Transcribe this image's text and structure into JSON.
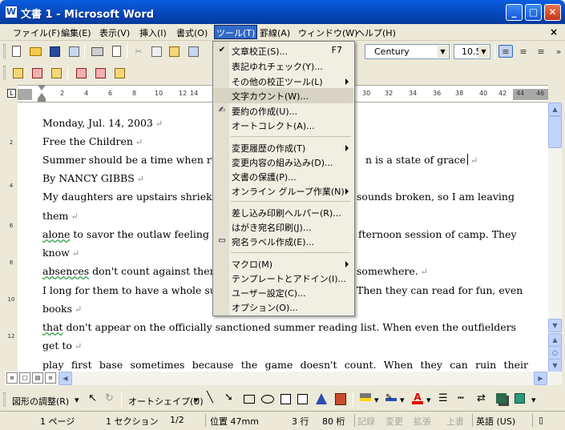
{
  "window": {
    "title": "文書 1 - Microsoft Word",
    "app_icon": "W",
    "controls": [
      "minimize-icon",
      "maximize-icon",
      "close-icon"
    ]
  },
  "menubar": {
    "items": [
      "ファイル(F)",
      "編集(E)",
      "表示(V)",
      "挿入(I)",
      "書式(O)",
      "ツール(T)",
      "罫線(A)",
      "ウィンドウ(W)",
      "ヘルプ(H)"
    ],
    "active_index": 5,
    "doc_close": "×"
  },
  "toolbar": {
    "font_name": "Century",
    "font_size": "10.5"
  },
  "ruler": {
    "ticks": [
      "2",
      "4",
      "6",
      "8",
      "10",
      "12",
      "14",
      "30",
      "32",
      "34",
      "36",
      "38",
      "40",
      "42",
      "44",
      "46"
    ],
    "vticks": [
      "2",
      "4",
      "6",
      "8",
      "10",
      "12"
    ]
  },
  "document": {
    "lines": [
      "Monday, Jul. 14, 2003",
      "Free the Children",
      "Summer should be a time when ru",
      "n is a state of grace",
      "By NANCY GIBBS",
      "My daughters are upstairs shriek",
      "sounds broken, so I am leaving",
      "them",
      "alone",
      " to savor the outlaw feeling",
      "fternoon session of camp. They",
      "know",
      "absences",
      " don't count against them",
      "somewhere.",
      "I long for them to have a whole su",
      "Then they can read for fun, even",
      "books",
      "that",
      " don't appear on the officially sanctioned summer reading list. When even the outfielders",
      "get to",
      "play first base sometimes because the game doesn't count. When they can ruin their"
    ],
    "para_mark": "↵"
  },
  "tools_menu": {
    "items": [
      {
        "label": "文章校正(S)...",
        "shortcut": "F7",
        "icon": "check-icon",
        "submenu": false
      },
      {
        "label": "表記ゆれチェック(Y)...",
        "shortcut": "",
        "icon": "",
        "submenu": false
      },
      {
        "label": "その他の校正ツール(L)",
        "shortcut": "",
        "icon": "",
        "submenu": true
      },
      {
        "label": "文字カウント(W)...",
        "shortcut": "",
        "icon": "",
        "submenu": false
      },
      {
        "label": "要約の作成(U)...",
        "shortcut": "",
        "icon": "summary-icon",
        "submenu": false
      },
      {
        "label": "オートコレクト(A)...",
        "shortcut": "",
        "icon": "",
        "submenu": false
      },
      {
        "label": "変更履歴の作成(T)",
        "shortcut": "",
        "icon": "",
        "submenu": true
      },
      {
        "label": "変更内容の組み込み(D)...",
        "shortcut": "",
        "icon": "",
        "submenu": false
      },
      {
        "label": "文書の保護(P)...",
        "shortcut": "",
        "icon": "",
        "submenu": false
      },
      {
        "label": "オンライン グループ作業(N)",
        "shortcut": "",
        "icon": "",
        "submenu": true
      },
      {
        "label": "差し込み印刷ヘルパー(R)...",
        "shortcut": "",
        "icon": "",
        "submenu": false
      },
      {
        "label": "はがき宛名印刷(J)...",
        "shortcut": "",
        "icon": "",
        "submenu": false
      },
      {
        "label": "宛名ラベル作成(E)...",
        "shortcut": "",
        "icon": "label-icon",
        "submenu": false
      },
      {
        "label": "マクロ(M)",
        "shortcut": "",
        "icon": "",
        "submenu": true
      },
      {
        "label": "テンプレートとアドイン(I)...",
        "shortcut": "",
        "icon": "",
        "submenu": false
      },
      {
        "label": "ユーザー設定(C)...",
        "shortcut": "",
        "icon": "",
        "submenu": false
      },
      {
        "label": "オプション(O)...",
        "shortcut": "",
        "icon": "",
        "submenu": false
      }
    ]
  },
  "drawbar": {
    "adjust_label": "図形の調整(R)",
    "autoshape_label": "オートシェイプ(U)"
  },
  "statusbar": {
    "page": "1 ページ",
    "section": "1 セクション",
    "pages": "1/2",
    "position": "位置 47mm",
    "line": "3 行",
    "column": "80 桁",
    "rec": "記録",
    "trk": "変更",
    "ext": "拡張",
    "ovr": "上書",
    "lang": "英語 (US)"
  }
}
